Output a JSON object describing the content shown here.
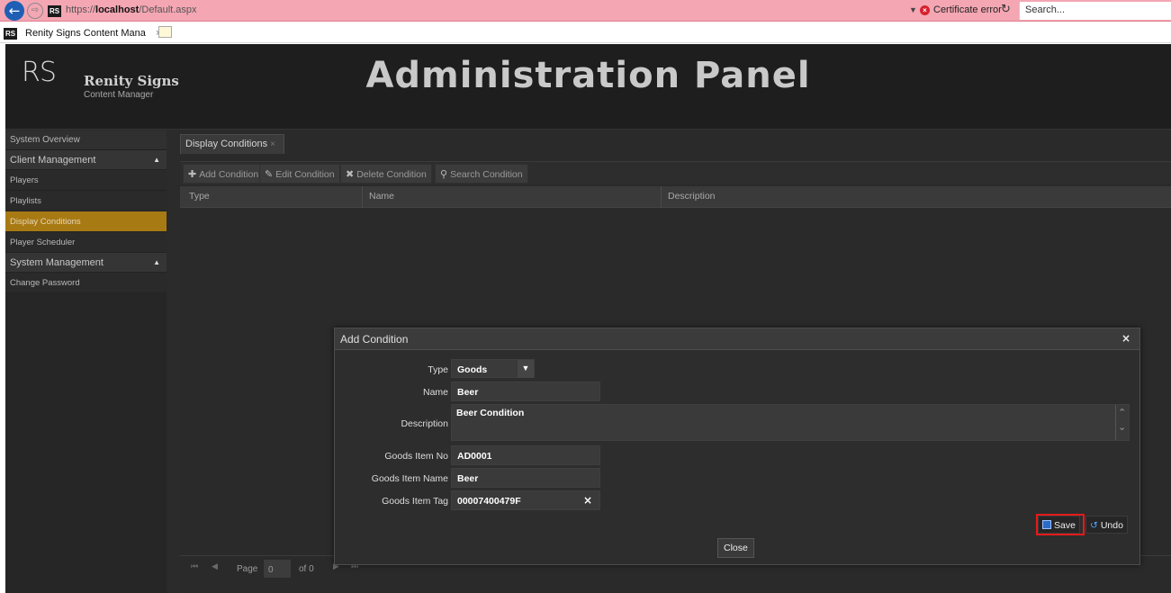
{
  "browser": {
    "url_prefix": "https://",
    "url_host": "localhost",
    "url_path": "/Default.aspx",
    "favicon_text": "RS",
    "cert_error": "Certificate error",
    "search_placeholder": "Search...",
    "tab_title": "Renity Signs Content Mana",
    "tab_close": "×"
  },
  "header": {
    "logo_mark": "RS",
    "brand_name": "Renity Signs",
    "brand_sub": "Content Manager",
    "title": "Administration Panel"
  },
  "sidebar": {
    "items": [
      {
        "label": "System Overview"
      },
      {
        "label": "Client Management"
      },
      {
        "label": "Players"
      },
      {
        "label": "Playlists"
      },
      {
        "label": "Display Conditions"
      },
      {
        "label": "Player Scheduler"
      },
      {
        "label": "System Management"
      },
      {
        "label": "Change Password"
      }
    ]
  },
  "content": {
    "tab_label": "Display Conditions",
    "toolbar": {
      "add": "Add Condition",
      "edit": "Edit Condition",
      "delete": "Delete Condition",
      "search": "Search Condition"
    },
    "columns": [
      "Type",
      "Name",
      "Description"
    ],
    "pager": {
      "page_label": "Page",
      "page_value": "0",
      "of_label": "of 0"
    }
  },
  "modal": {
    "title": "Add Condition",
    "close_icon": "×",
    "fields": {
      "type_label": "Type",
      "type_value": "Goods",
      "name_label": "Name",
      "name_value": "Beer",
      "description_label": "Description",
      "description_value": "Beer Condition",
      "item_no_label": "Goods Item No",
      "item_no_value": "AD0001",
      "item_name_label": "Goods Item Name",
      "item_name_value": "Beer",
      "item_tag_label": "Goods Item Tag",
      "item_tag_value": "00007400479F"
    },
    "buttons": {
      "save": "Save",
      "undo": "Undo",
      "close": "Close"
    },
    "highlight_color": "#e51a1a"
  },
  "colors": {
    "address_bar": "#f4a6b3",
    "active_sidebar": "#a87a14",
    "background": "#2b2b2b"
  }
}
